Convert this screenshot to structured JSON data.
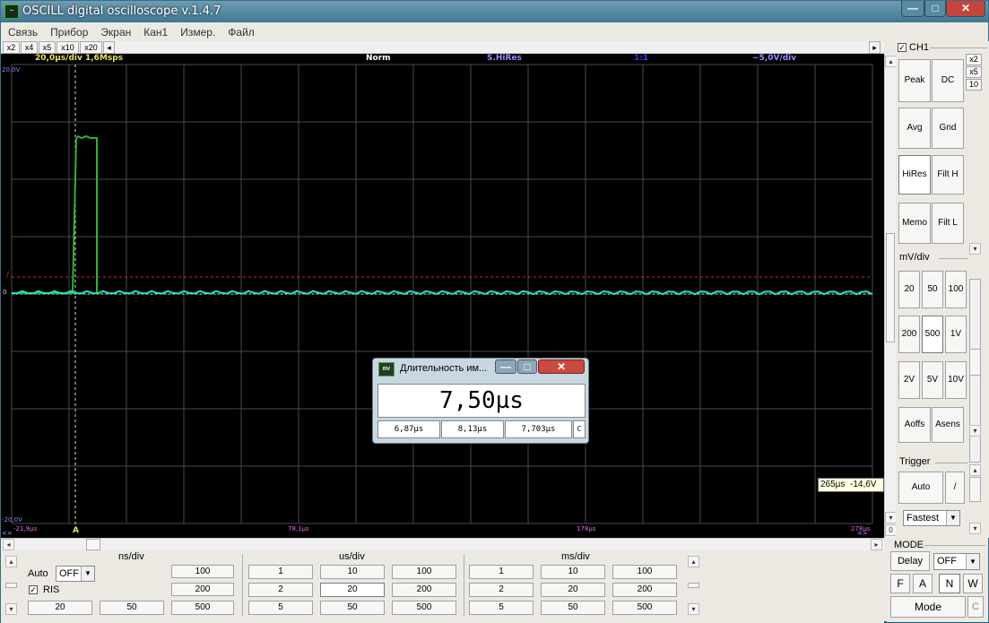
{
  "window": {
    "icon": "osc-icon",
    "title": "OSCILL digital oscilloscope  v.1.4.7",
    "buttons": {
      "minimize": "—",
      "maximize": "□",
      "close": "✕"
    }
  },
  "menu": [
    "Связь",
    "Прибор",
    "Экран",
    "Кан1",
    "Измер.",
    "Файл"
  ],
  "zoom_buttons": [
    "x2",
    "x4",
    "x5",
    "x10",
    "x20"
  ],
  "scope": {
    "timebase": "20,0µs/div  1,6Msps",
    "trigger_mode": "Norm",
    "filter": "S.HiRes",
    "ratio": "1:1",
    "vdiv": "~5,0V/div",
    "v_top": "20,0V",
    "v_zero": "0",
    "v_bottom": "-20,0V",
    "t_left": "-21,9µs",
    "t_mid1": "78,1µs",
    "t_mid2": "178µs",
    "t_right": "278µs",
    "trig_marker": "/",
    "trig_pos_marker": "A",
    "left_arrow": "<=",
    "right_arrow": "=>",
    "colors": {
      "grid": "#4a4a4a",
      "trace_green": "#2fb33a",
      "trace_cyan": "#27e2c9",
      "trigger_level": "#d12a2a",
      "info_yellow": "#e8e35a",
      "info_white": "#ffffff",
      "info_blue": "#3a3af0",
      "info_violet": "#9a8aff"
    }
  },
  "channel": {
    "label": "CH1",
    "checked": "✓",
    "buttons": [
      "Peak",
      "DC",
      "Avg",
      "Gnd",
      "HiRes",
      "Filt H",
      "Memo",
      "Filt L"
    ],
    "multipliers": [
      "x2",
      "x5",
      "10"
    ],
    "mvdiv_label": "mV/div",
    "mvdiv_values": [
      "20",
      "50",
      "100",
      "200",
      "500",
      "1V",
      "2V",
      "5V",
      "10V"
    ],
    "aoffs": "Aoffs",
    "asens": "Asens"
  },
  "trigger": {
    "label": "Trigger",
    "auto": "Auto",
    "slope": "/",
    "speed": "Fastest"
  },
  "tooltip": {
    "time": "265µs",
    "volt": "-14,6V"
  },
  "popup": {
    "icon": "mv-icon",
    "title": "Длительность им...",
    "main_value": "7,50µs",
    "min": "6,87µs",
    "max": "8,13µs",
    "avg": "7,703µs",
    "reset": "C",
    "buttons": {
      "minimize": "—",
      "maximize": "□",
      "close": "✕"
    }
  },
  "bottom": {
    "ns_label": "ns/div",
    "us_label": "us/div",
    "ms_label": "ms/div",
    "auto_label": "Auto",
    "auto_value": "OFF",
    "ris_label": "RIS",
    "ris_check": "✓",
    "ns_values": [
      "100",
      "200",
      "500",
      "20",
      "50"
    ],
    "us_values": [
      "1",
      "10",
      "100",
      "2",
      "20",
      "200",
      "5",
      "50",
      "500"
    ],
    "ms_values": [
      "1",
      "10",
      "100",
      "2",
      "20",
      "200",
      "5",
      "50",
      "500"
    ]
  },
  "mode": {
    "label": "MODE",
    "delay": "Delay",
    "delay_value": "OFF",
    "fan": [
      "F",
      "A",
      "N",
      "W"
    ],
    "mode_button": "Mode",
    "c_button": "C"
  }
}
